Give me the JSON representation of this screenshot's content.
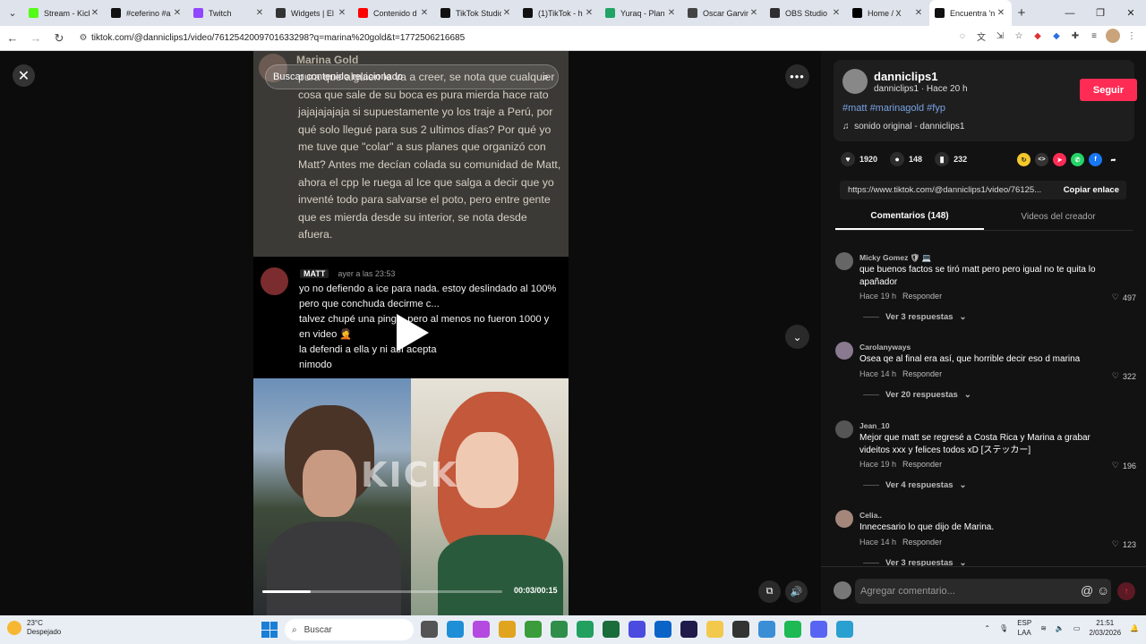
{
  "browser": {
    "tabs": [
      {
        "title": "Stream - Kick",
        "color": "#53fc18"
      },
      {
        "title": "#ceferino #a",
        "color": "#111111"
      },
      {
        "title": "Twitch",
        "color": "#9146ff"
      },
      {
        "title": "Widgets | El",
        "color": "#333333"
      },
      {
        "title": "Contenido d",
        "color": "#ff0000"
      },
      {
        "title": "TikTok Studio",
        "color": "#111111"
      },
      {
        "title": "(1)TikTok - h",
        "color": "#111111"
      },
      {
        "title": "Yuraq - Plan",
        "color": "#21a366"
      },
      {
        "title": "Oscar Garvin",
        "color": "#444444"
      },
      {
        "title": "OBS Studio",
        "color": "#302e31"
      },
      {
        "title": "Home / X",
        "color": "#000000"
      },
      {
        "title": "Encuentra 'n",
        "color": "#111111"
      }
    ],
    "url": "tiktok.com/@danniclips1/video/7612542009701633298?q=marina%20gold&t=1772506216685"
  },
  "video": {
    "search_placeholder": "Buscar contenido relacionado",
    "top_header": "Marina Gold",
    "top_text": "pura que alguien le va a creer, se nota que cualquier cosa que sale de su boca es pura mierda hace rato jajajajajaja si supuestamente yo los traje a Perú, por qué solo llegué para sus 2 ultimos días? Por qué yo me tuve que \"colar\" a sus planes que organizó con Matt? Antes me decían colada su comunidad de Matt, ahora el cpp le ruega al Ice que salga a decir que yo inventé todo para salvarse el poto, pero entre gente que es mierda desde su interior, se nota desde afuera.",
    "mid_name": "MATT",
    "mid_time": "ayer a las 23:53",
    "mid_lines": [
      "yo no defiendo a ice para nada. estoy deslindado al 100%",
      "pero que conchuda decirme c...",
      "talvez chupé una ping... pero al menos no fueron 1000 y",
      "en video 🤦",
      "la defendi a ella y ni así acepta",
      "nimodo"
    ],
    "watermark": "KICK",
    "time": "00:03/00:15",
    "progress": 0.2
  },
  "panel": {
    "username": "danniclips1",
    "subline": "danniclips1 · Hace 20 h",
    "follow_label": "Seguir",
    "hashtags": "#matt #marinagold #fyp",
    "sound": "sonido original - danniclips1",
    "likes": "1920",
    "comments_count": "148",
    "saves": "232",
    "link": "https://www.tiktok.com/@danniclips1/video/76125...",
    "copy_label": "Copiar enlace",
    "tab_comments": "Comentarios (148)",
    "tab_videos": "Videos del creador",
    "comments": [
      {
        "name": "Micky Gomez 🛡 💻",
        "text": "que buenos factos se tiró matt pero pero igual no te quita lo apañador",
        "time": "Hace 19 h",
        "reply": "Responder",
        "likes": "497",
        "replies": "Ver 3 respuestas"
      },
      {
        "name": "Carolanyways",
        "text": "Osea qe al final era así, que horrible decir eso d marina",
        "time": "Hace 14 h",
        "reply": "Responder",
        "likes": "322",
        "replies": "Ver 20 respuestas"
      },
      {
        "name": "Jean_10",
        "text": "Mejor que matt se regresé a Costa Rica y Marina a grabar videitos xxx y felices todos xD [ステッカー]",
        "time": "Hace 19 h",
        "reply": "Responder",
        "likes": "196",
        "replies": "Ver 4 respuestas"
      },
      {
        "name": "Celia..",
        "text": "Innecesario lo que dijo de Marina.",
        "time": "Hace 14 h",
        "reply": "Responder",
        "likes": "123",
        "replies": "Ver 3 respuestas"
      }
    ],
    "comment_placeholder": "Agregar comentario..."
  },
  "taskbar": {
    "temp": "23°C",
    "weather": "Despejado",
    "search": "Buscar",
    "lang1": "ESP",
    "lang2": "LAA",
    "time": "21:51",
    "date": "2/03/2026"
  }
}
